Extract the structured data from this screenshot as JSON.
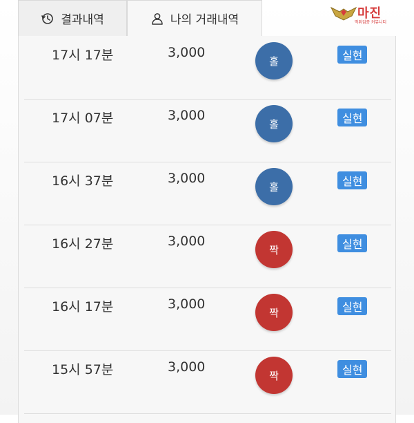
{
  "tabs": {
    "results_label": "결과내역",
    "mine_label": "나의 거래내역"
  },
  "logo": {
    "title": "마진",
    "subtitle": "먹튀검증 커뮤니티"
  },
  "colors": {
    "odd": "#3c6ea8",
    "even": "#c23632",
    "status": "#3f8ee0"
  },
  "rows": [
    {
      "time": "17시 17분",
      "amount": "3,000",
      "pick": "홀",
      "status": "실현"
    },
    {
      "time": "17시 07분",
      "amount": "3,000",
      "pick": "홀",
      "status": "실현"
    },
    {
      "time": "16시 37분",
      "amount": "3,000",
      "pick": "홀",
      "status": "실현"
    },
    {
      "time": "16시 27분",
      "amount": "3,000",
      "pick": "짝",
      "status": "실현"
    },
    {
      "time": "16시 17분",
      "amount": "3,000",
      "pick": "짝",
      "status": "실현"
    },
    {
      "time": "15시 57분",
      "amount": "3,000",
      "pick": "짝",
      "status": "실현"
    }
  ]
}
